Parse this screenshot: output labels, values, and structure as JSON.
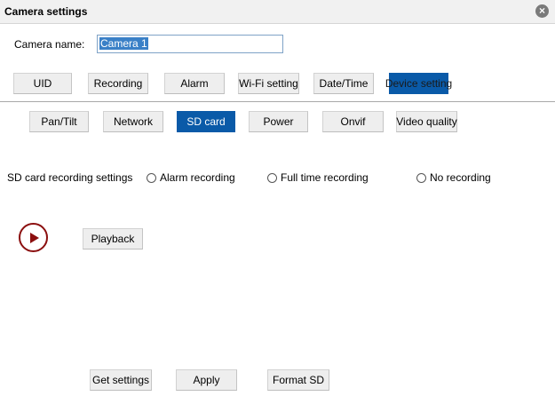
{
  "window": {
    "title": "Camera settings"
  },
  "camera_name": {
    "label": "Camera name:",
    "value": "Camera 1"
  },
  "main_tabs": [
    {
      "label": "UID"
    },
    {
      "label": "Recording"
    },
    {
      "label": "Alarm"
    },
    {
      "label": "Wi-Fi setting"
    },
    {
      "label": "Date/Time"
    },
    {
      "label": "Device setting",
      "active": true
    }
  ],
  "sub_tabs": [
    {
      "label": "Pan/Tilt"
    },
    {
      "label": "Network"
    },
    {
      "label": "SD card",
      "active": true
    },
    {
      "label": "Power"
    },
    {
      "label": "Onvif"
    },
    {
      "label": "Video quality"
    }
  ],
  "sd_card": {
    "label": "SD card recording settings",
    "options": [
      {
        "label": "Alarm recording",
        "checked": false
      },
      {
        "label": "Full time recording",
        "checked": false
      },
      {
        "label": "No recording",
        "checked": false
      }
    ],
    "playback_label": "Playback"
  },
  "footer": {
    "get_settings_label": "Get settings",
    "apply_label": "Apply",
    "format_sd_label": "Format SD"
  },
  "colors": {
    "active_tab": "#0a5aa8",
    "play_icon": "#8b0f0f",
    "selection": "#3a80c7"
  }
}
